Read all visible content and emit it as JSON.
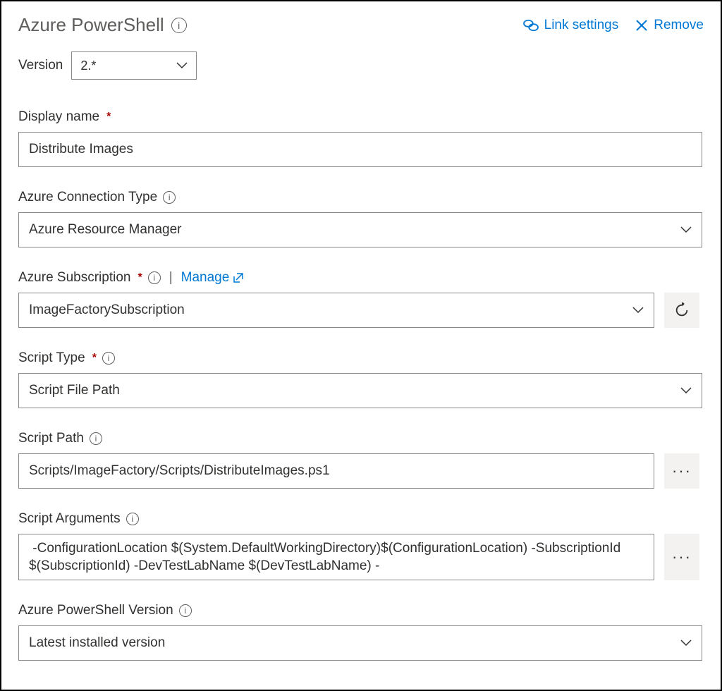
{
  "header": {
    "title": "Azure PowerShell",
    "link_settings": "Link settings",
    "remove": "Remove"
  },
  "version": {
    "label": "Version",
    "value": "2.*"
  },
  "fields": {
    "display_name": {
      "label": "Display name",
      "value": "Distribute Images"
    },
    "connection_type": {
      "label": "Azure Connection Type",
      "value": "Azure Resource Manager"
    },
    "subscription": {
      "label": "Azure Subscription",
      "manage": "Manage",
      "value": "ImageFactorySubscription"
    },
    "script_type": {
      "label": "Script Type",
      "value": "Script File Path"
    },
    "script_path": {
      "label": "Script Path",
      "value": "Scripts/ImageFactory/Scripts/DistributeImages.ps1"
    },
    "script_args": {
      "label": "Script Arguments",
      "value": " -ConfigurationLocation $(System.DefaultWorkingDirectory)$(ConfigurationLocation) -SubscriptionId $(SubscriptionId) -DevTestLabName $(DevTestLabName) -"
    },
    "ps_version": {
      "label": "Azure PowerShell Version",
      "value": "Latest installed version"
    }
  }
}
